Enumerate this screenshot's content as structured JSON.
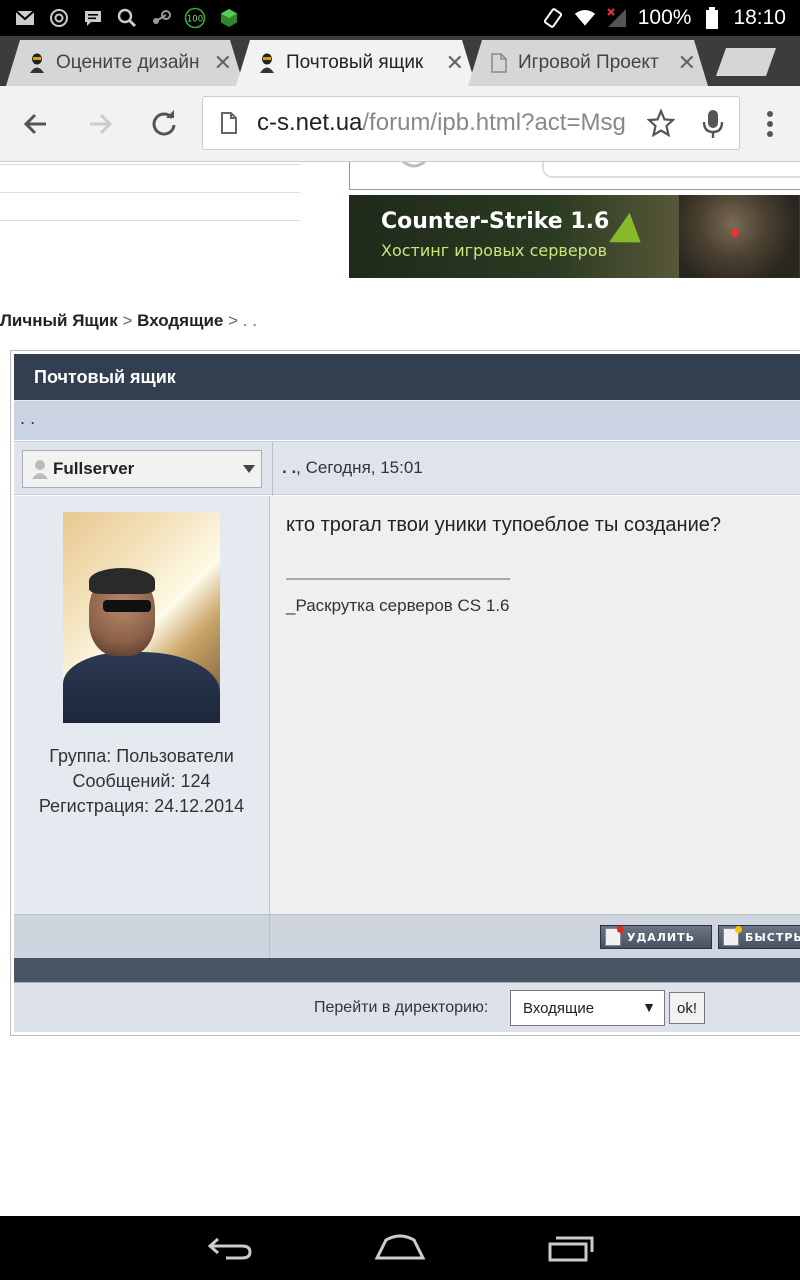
{
  "status_bar": {
    "battery_percent": "100%",
    "time": "18:10",
    "icons": [
      "mail-icon",
      "at-icon",
      "chat-icon",
      "search-icon",
      "steam-icon",
      "counter-100-icon",
      "android-icon",
      "rotate-icon",
      "wifi-icon",
      "signal-icon",
      "battery-icon"
    ],
    "badge_100": "100"
  },
  "tabs": [
    {
      "title": "Оцените дизайн",
      "active": false
    },
    {
      "title": "Почтовый ящик",
      "active": true
    },
    {
      "title": "Игровой Проект",
      "active": false
    }
  ],
  "toolbar": {
    "url_host": "c-s.net.ua",
    "url_path": "/forum/ipb.html?act=Msg"
  },
  "banner": {
    "title": "Counter-Strike 1.6",
    "subtitle": "Хостинг игровых серверов"
  },
  "breadcrumb": {
    "item1": "Личный Ящик",
    "sep": ">",
    "item2": "Входящие",
    "item3": ". ."
  },
  "mailbox": {
    "header": "Почтовый ящик",
    "subtitle": ". .",
    "post": {
      "author": "Fullserver",
      "date_prefix": ". .",
      "date": ", Сегодня, 15:01",
      "group": "Группа: Пользователи",
      "posts": "Сообщений: 124",
      "registered": "Регистрация: 24.12.2014",
      "message": "кто трогал твои уники тупоеблое ты создание?",
      "signature": "_Раскрутка серверов CS 1.6"
    },
    "buttons": {
      "delete": "УДАЛИТЬ",
      "reply": "БЫСТРЫЙ"
    },
    "goto": {
      "label": "Перейти в директорию:",
      "selected": "Входящие",
      "ok": "ok!"
    }
  }
}
